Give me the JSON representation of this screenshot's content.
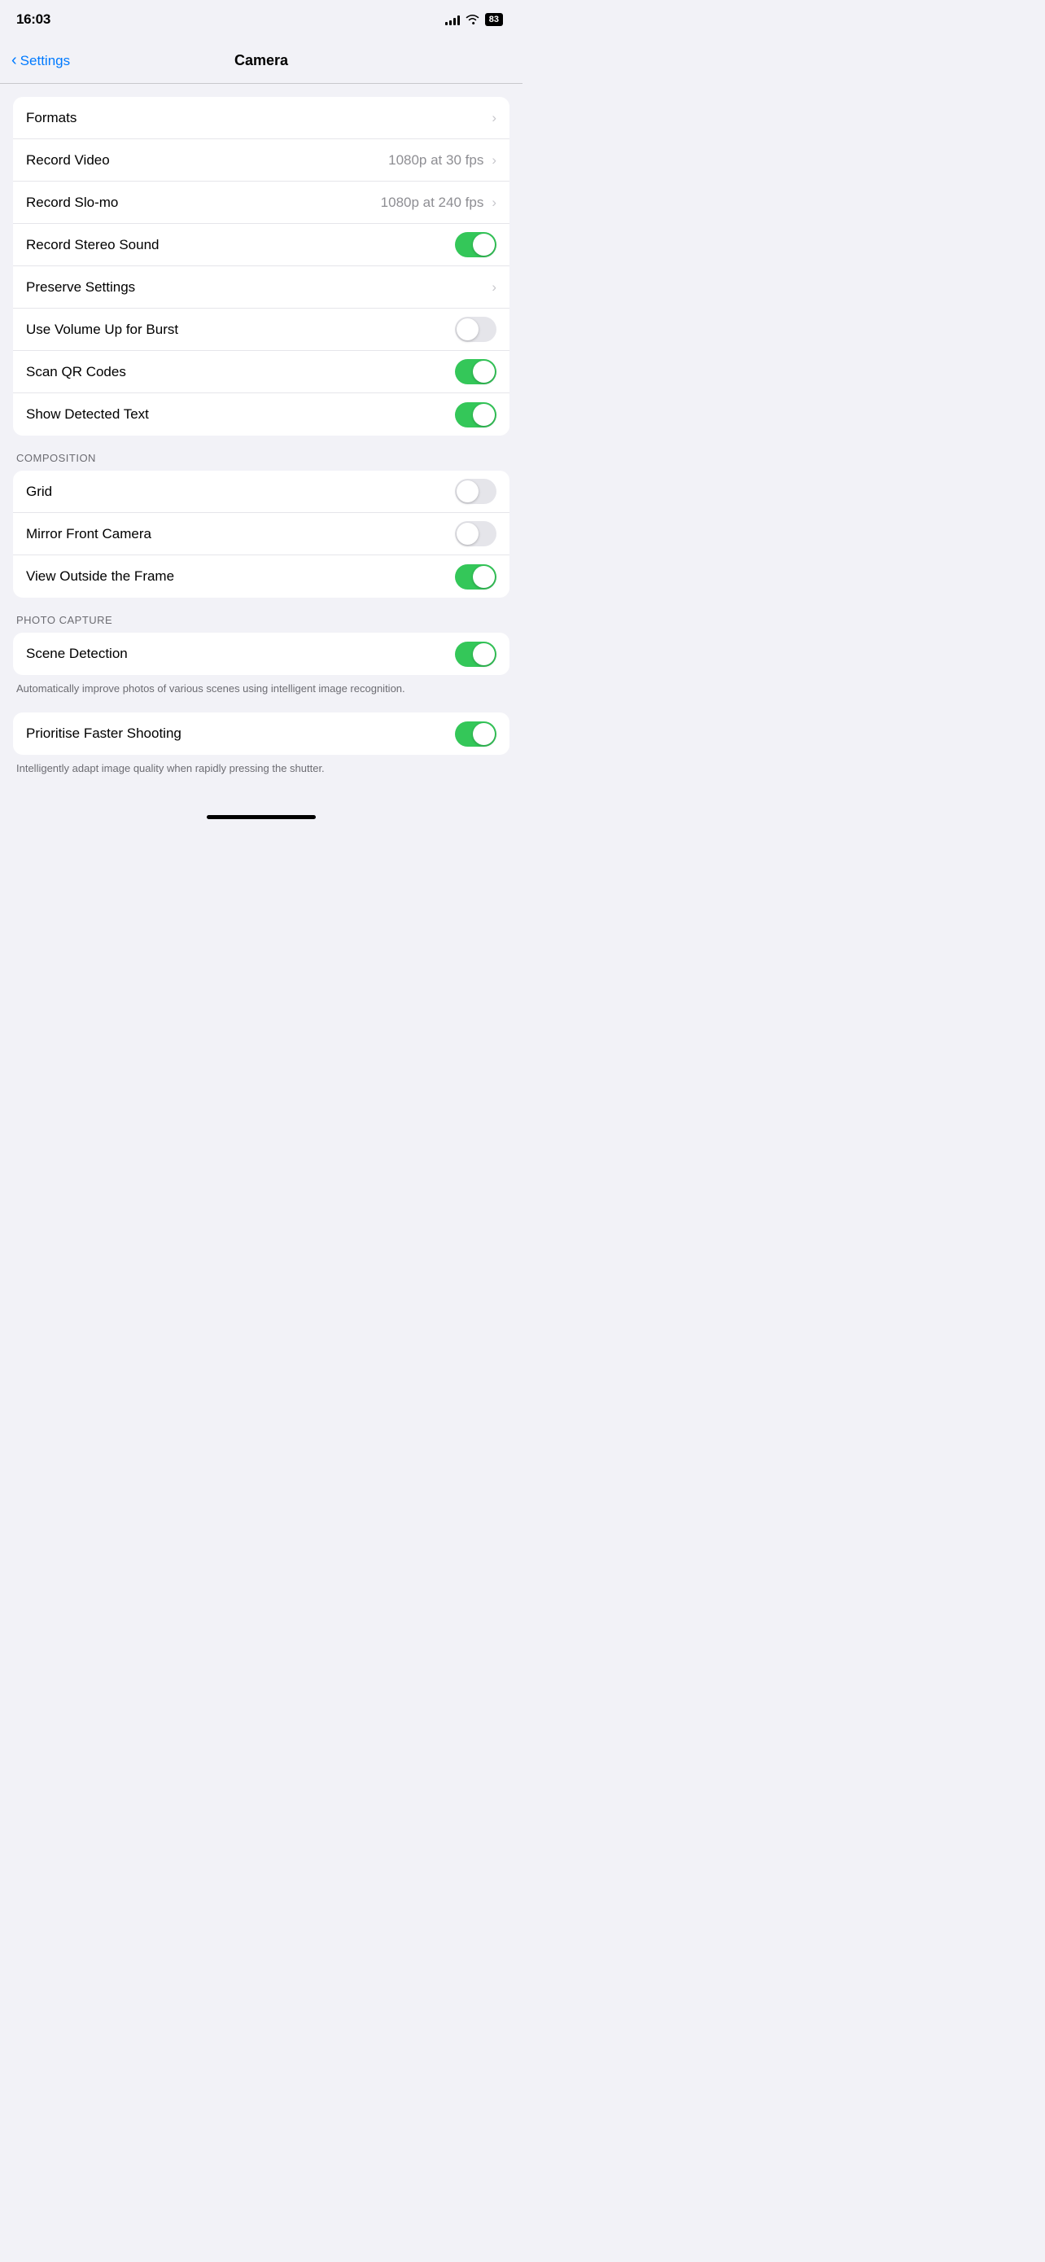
{
  "statusBar": {
    "time": "16:03",
    "battery": "83"
  },
  "navBar": {
    "backLabel": "Settings",
    "title": "Camera"
  },
  "sections": [
    {
      "id": "main",
      "header": null,
      "footer": null,
      "rows": [
        {
          "id": "formats",
          "label": "Formats",
          "type": "chevron",
          "value": null
        },
        {
          "id": "record-video",
          "label": "Record Video",
          "type": "chevron",
          "value": "1080p at 30 fps"
        },
        {
          "id": "record-slomo",
          "label": "Record Slo-mo",
          "type": "chevron",
          "value": "1080p at 240 fps"
        },
        {
          "id": "record-stereo-sound",
          "label": "Record Stereo Sound",
          "type": "toggle",
          "value": true
        },
        {
          "id": "preserve-settings",
          "label": "Preserve Settings",
          "type": "chevron",
          "value": null
        },
        {
          "id": "volume-burst",
          "label": "Use Volume Up for Burst",
          "type": "toggle",
          "value": false
        },
        {
          "id": "scan-qr",
          "label": "Scan QR Codes",
          "type": "toggle",
          "value": true
        },
        {
          "id": "show-detected-text",
          "label": "Show Detected Text",
          "type": "toggle",
          "value": true
        }
      ]
    },
    {
      "id": "composition",
      "header": "COMPOSITION",
      "footer": null,
      "rows": [
        {
          "id": "grid",
          "label": "Grid",
          "type": "toggle",
          "value": false
        },
        {
          "id": "mirror-front",
          "label": "Mirror Front Camera",
          "type": "toggle",
          "value": false
        },
        {
          "id": "view-outside-frame",
          "label": "View Outside the Frame",
          "type": "toggle",
          "value": true
        }
      ]
    },
    {
      "id": "photo-capture",
      "header": "PHOTO CAPTURE",
      "footer": null,
      "rows": [
        {
          "id": "scene-detection",
          "label": "Scene Detection",
          "type": "toggle",
          "value": true
        }
      ]
    },
    {
      "id": "scene-footer",
      "footer": "Automatically improve photos of various scenes using intelligent image recognition."
    },
    {
      "id": "faster-shooting-section",
      "header": null,
      "footer": null,
      "rows": [
        {
          "id": "prioritise-faster",
          "label": "Prioritise Faster Shooting",
          "type": "toggle",
          "value": true
        }
      ]
    },
    {
      "id": "faster-footer",
      "footer": "Intelligently adapt image quality when rapidly pressing the shutter."
    }
  ]
}
